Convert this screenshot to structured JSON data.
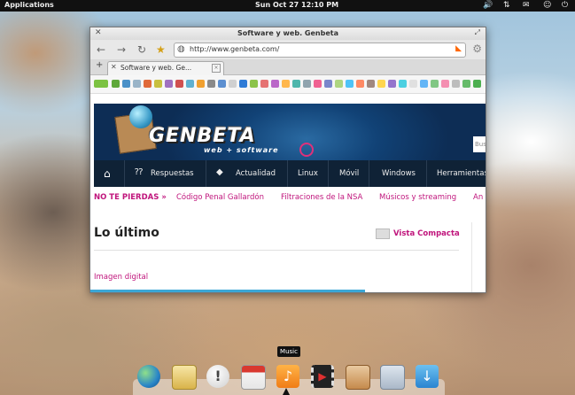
{
  "topbar": {
    "applications": "Applications",
    "clock": "Sun Oct 27 12:10 PM"
  },
  "window": {
    "title": "Software y web. Genbeta",
    "url": "http://www.genbeta.com/",
    "tab_label": "Software y web. Ge..."
  },
  "page": {
    "logo_text": "GENBETA",
    "logo_subtext": "web + software",
    "search_placeholder": "Bus",
    "menu": [
      "Respuestas",
      "Actualidad",
      "Linux",
      "Móvil",
      "Windows",
      "Herramientas"
    ],
    "no_te_pierdas": "NO TE PIERDAS »",
    "links": [
      "Código Penal Gallardón",
      "Filtraciones de la NSA",
      "Músicos y streaming",
      "An"
    ],
    "heading": "Lo último",
    "vista_compacta": "Vista Compacta",
    "imagen_digital": "Imagen digital"
  },
  "dock": {
    "tooltip": "Music",
    "items": [
      "web-browser",
      "mail",
      "chat",
      "calendar",
      "music",
      "video",
      "photos",
      "settings",
      "software-center"
    ]
  },
  "colors": {
    "accent": "#c0157c",
    "menu_bg": "#0f2236",
    "banner_bg": "#114276"
  }
}
